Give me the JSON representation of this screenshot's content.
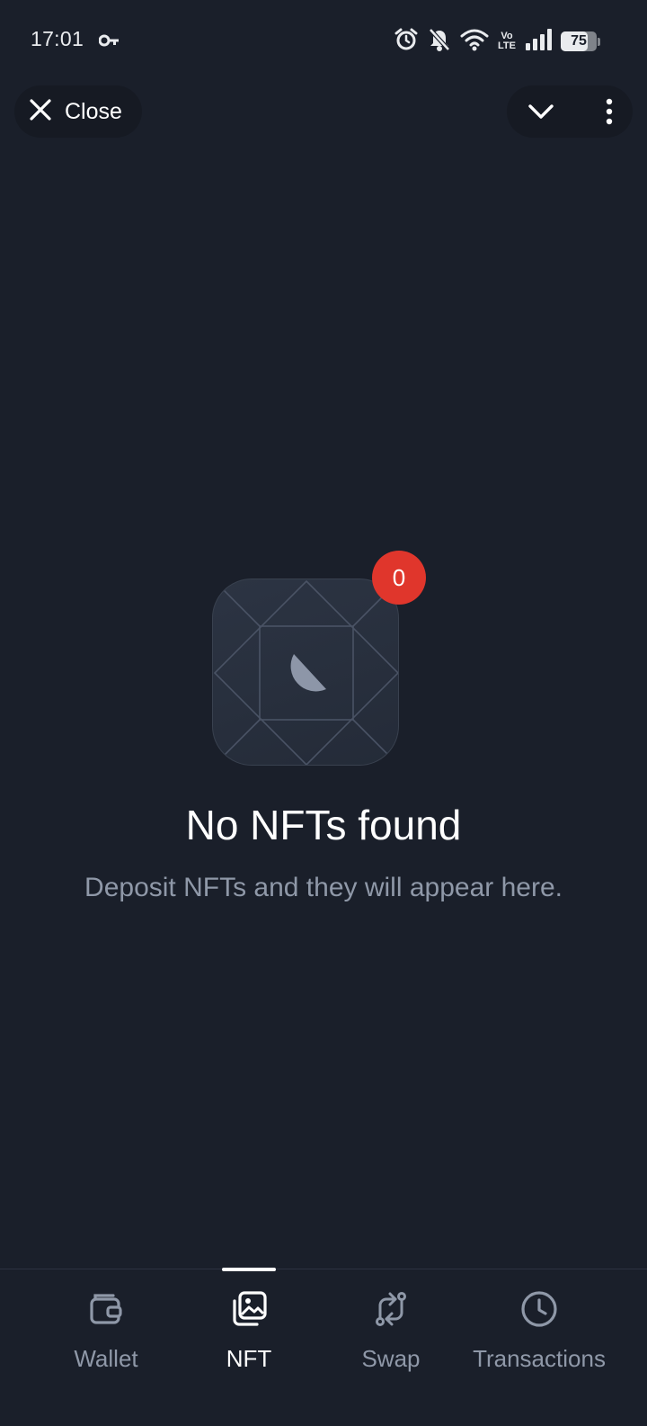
{
  "status_bar": {
    "time": "17:01",
    "network": "Vo LTE",
    "network_top": "Vo",
    "network_bottom": "LTE",
    "battery": "75",
    "battery_level": 0.75,
    "icons": [
      "key-icon",
      "alarm-icon",
      "bell-off-icon",
      "wifi-icon",
      "signal-icon",
      "battery-icon"
    ]
  },
  "header": {
    "close_label": "Close",
    "icons": [
      "close-icon",
      "chevron-down-icon",
      "more-vertical-icon"
    ]
  },
  "empty_state": {
    "badge_count": "0",
    "title": "No NFTs found",
    "subtitle": "Deposit NFTs and they will appear here."
  },
  "bottom_nav": {
    "items": [
      {
        "label": "Wallet",
        "icon": "wallet-icon",
        "active": false
      },
      {
        "label": "NFT",
        "icon": "nft-gallery-icon",
        "active": true
      },
      {
        "label": "Swap",
        "icon": "swap-icon",
        "active": false
      },
      {
        "label": "Transactions",
        "icon": "clock-icon",
        "active": false
      }
    ]
  },
  "colors": {
    "background": "#1a1f2a",
    "badge": "#e0362c",
    "muted_text": "#8f98a8",
    "active_text": "#ffffff"
  }
}
